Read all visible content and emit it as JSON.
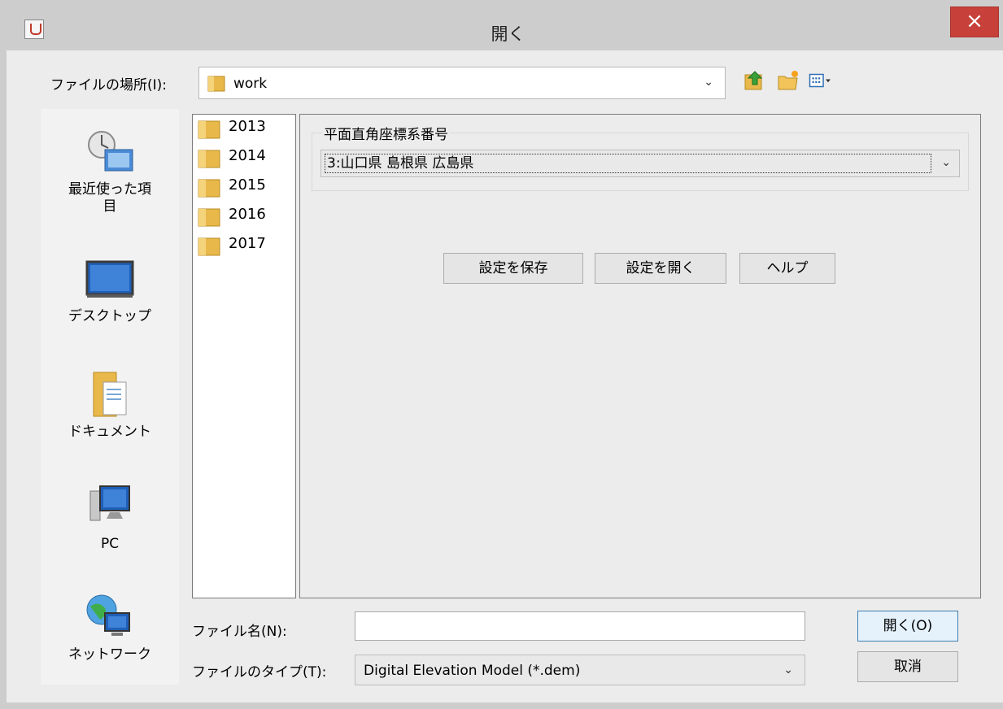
{
  "window": {
    "title": "開く",
    "close_glyph": "×"
  },
  "lookin": {
    "label": "ファイルの場所(I):",
    "value": "work"
  },
  "toolbar": {
    "up_icon": "folder-up-icon",
    "new_folder_icon": "new-folder-icon",
    "view_icon": "view-menu-icon"
  },
  "places": [
    {
      "label": "最近使った項\n目",
      "icon": "recent-items-icon"
    },
    {
      "label": "デスクトップ",
      "icon": "desktop-icon"
    },
    {
      "label": "ドキュメント",
      "icon": "documents-icon"
    },
    {
      "label": "PC",
      "icon": "pc-icon"
    },
    {
      "label": "ネットワーク",
      "icon": "network-icon"
    }
  ],
  "files": [
    "2013",
    "2014",
    "2015",
    "2016",
    "2017"
  ],
  "accessory": {
    "group_title": "平面直角座標系番号",
    "selected": "3:山口県 島根県 広島県",
    "buttons": {
      "save": "設定を保存",
      "open": "設定を開く",
      "help": "ヘルプ"
    }
  },
  "filename": {
    "label": "ファイル名(N):",
    "value": ""
  },
  "filetype": {
    "label": "ファイルのタイプ(T):",
    "value": "Digital Elevation Model (*.dem)"
  },
  "actions": {
    "open": "開く(O)",
    "cancel": "取消"
  },
  "colors": {
    "close": "#c7403a",
    "folder": "#e8b84a",
    "accent": "#3c7fb1"
  }
}
